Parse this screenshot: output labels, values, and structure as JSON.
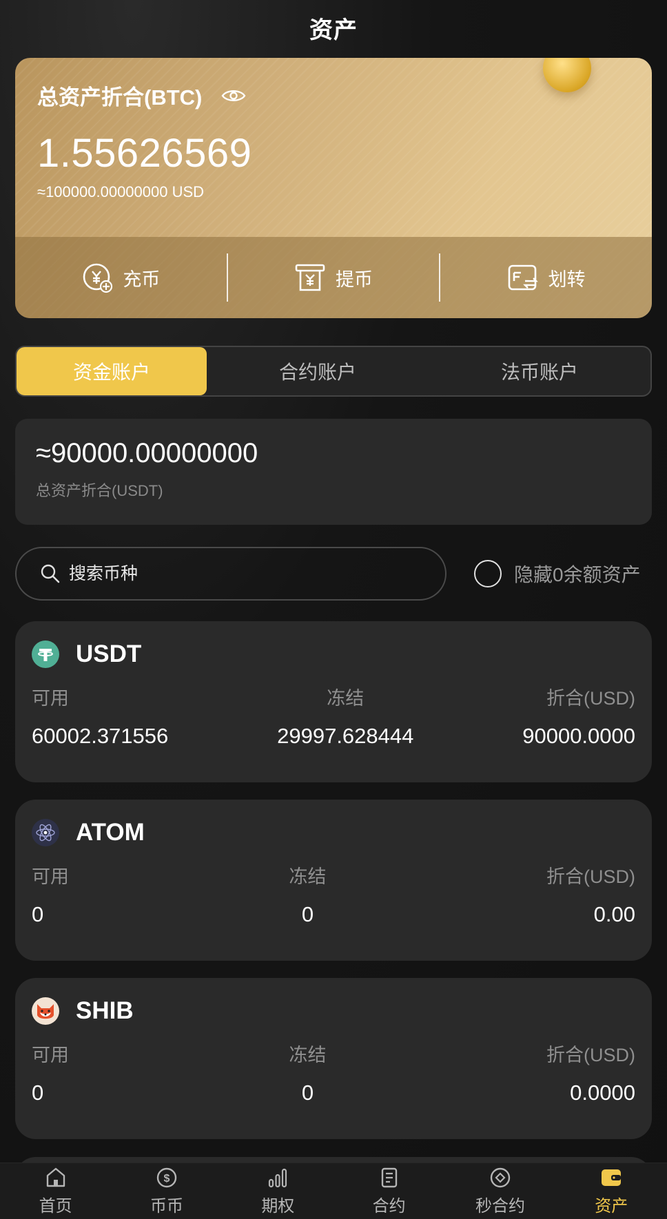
{
  "header": {
    "title": "资产"
  },
  "card": {
    "label": "总资产折合(BTC)",
    "value": "1.55626569",
    "usd": "≈100000.00000000 USD",
    "actions": [
      {
        "label": "充币",
        "icon": "deposit-coin-icon"
      },
      {
        "label": "提币",
        "icon": "withdraw-coin-icon"
      },
      {
        "label": "划转",
        "icon": "transfer-icon"
      }
    ]
  },
  "tabs": [
    {
      "label": "资金账户",
      "active": true
    },
    {
      "label": "合约账户",
      "active": false
    },
    {
      "label": "法币账户",
      "active": false
    }
  ],
  "summary": {
    "value": "≈90000.00000000",
    "label": "总资产折合(USDT)"
  },
  "search": {
    "placeholder": "搜索币种",
    "value": ""
  },
  "hide_zero": {
    "label": "隐藏0余额资产",
    "checked": false
  },
  "asset_columns": {
    "available": "可用",
    "frozen": "冻结",
    "converted": "折合(USD)"
  },
  "assets": [
    {
      "name": "USDT",
      "available": "60002.371556",
      "frozen": "29997.628444",
      "converted": "90000.0000",
      "icon": "tether-icon",
      "color": "#50af95"
    },
    {
      "name": "ATOM",
      "available": "0",
      "frozen": "0",
      "converted": "0.00",
      "icon": "cosmos-atom-icon",
      "color": "#2e3148"
    },
    {
      "name": "SHIB",
      "available": "0",
      "frozen": "0",
      "converted": "0.0000",
      "icon": "shiba-inu-icon",
      "color": "#e5502a"
    }
  ],
  "bottom_nav": [
    {
      "label": "首页",
      "icon": "home-icon",
      "active": false
    },
    {
      "label": "币币",
      "icon": "coin-dollar-icon",
      "active": false
    },
    {
      "label": "期权",
      "icon": "bar-chart-icon",
      "active": false
    },
    {
      "label": "合约",
      "icon": "document-icon",
      "active": false
    },
    {
      "label": "秒合约",
      "icon": "diamond-circle-icon",
      "active": false
    },
    {
      "label": "资产",
      "icon": "wallet-icon",
      "active": true
    }
  ],
  "colors": {
    "accent": "#f0c74b",
    "card_bg": "#2a2a2a",
    "gold": "#d4b27a"
  }
}
